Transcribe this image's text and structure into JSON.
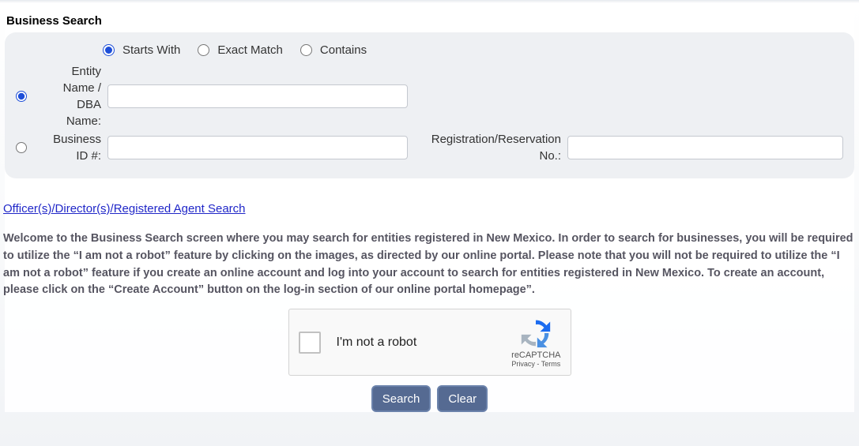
{
  "panel": {
    "title": "Business Search"
  },
  "matchType": {
    "starts_with": "Starts With",
    "exact_match": "Exact Match",
    "contains": "Contains",
    "selected": "starts_with"
  },
  "fields": {
    "entity_label": "Entity Name / DBA Name:",
    "entity_value": "",
    "business_id_label": "Business ID #:",
    "business_id_value": "",
    "reg_label": "Registration/Reservation No.:",
    "reg_value": "",
    "row_selected": "entity"
  },
  "link": {
    "officer_search": "Officer(s)/Director(s)/Registered Agent Search"
  },
  "welcome_text": "Welcome to the Business Search screen where you may search for entities registered in New Mexico. In order to search for businesses, you will be required to utilize the “I am not a robot” feature by clicking on the images, as directed by our online portal. Please note that you will not be required to utilize the “I am not a robot” feature if you create an online account and log into your account to search for entities registered in New Mexico. To create an account, please click on the “Create Account” button on the log-in section of our online portal homepage”.",
  "recaptcha": {
    "label": "I'm not a robot",
    "brand": "reCAPTCHA",
    "privacy_terms": "Privacy - Terms"
  },
  "buttons": {
    "search": "Search",
    "clear": "Clear"
  }
}
